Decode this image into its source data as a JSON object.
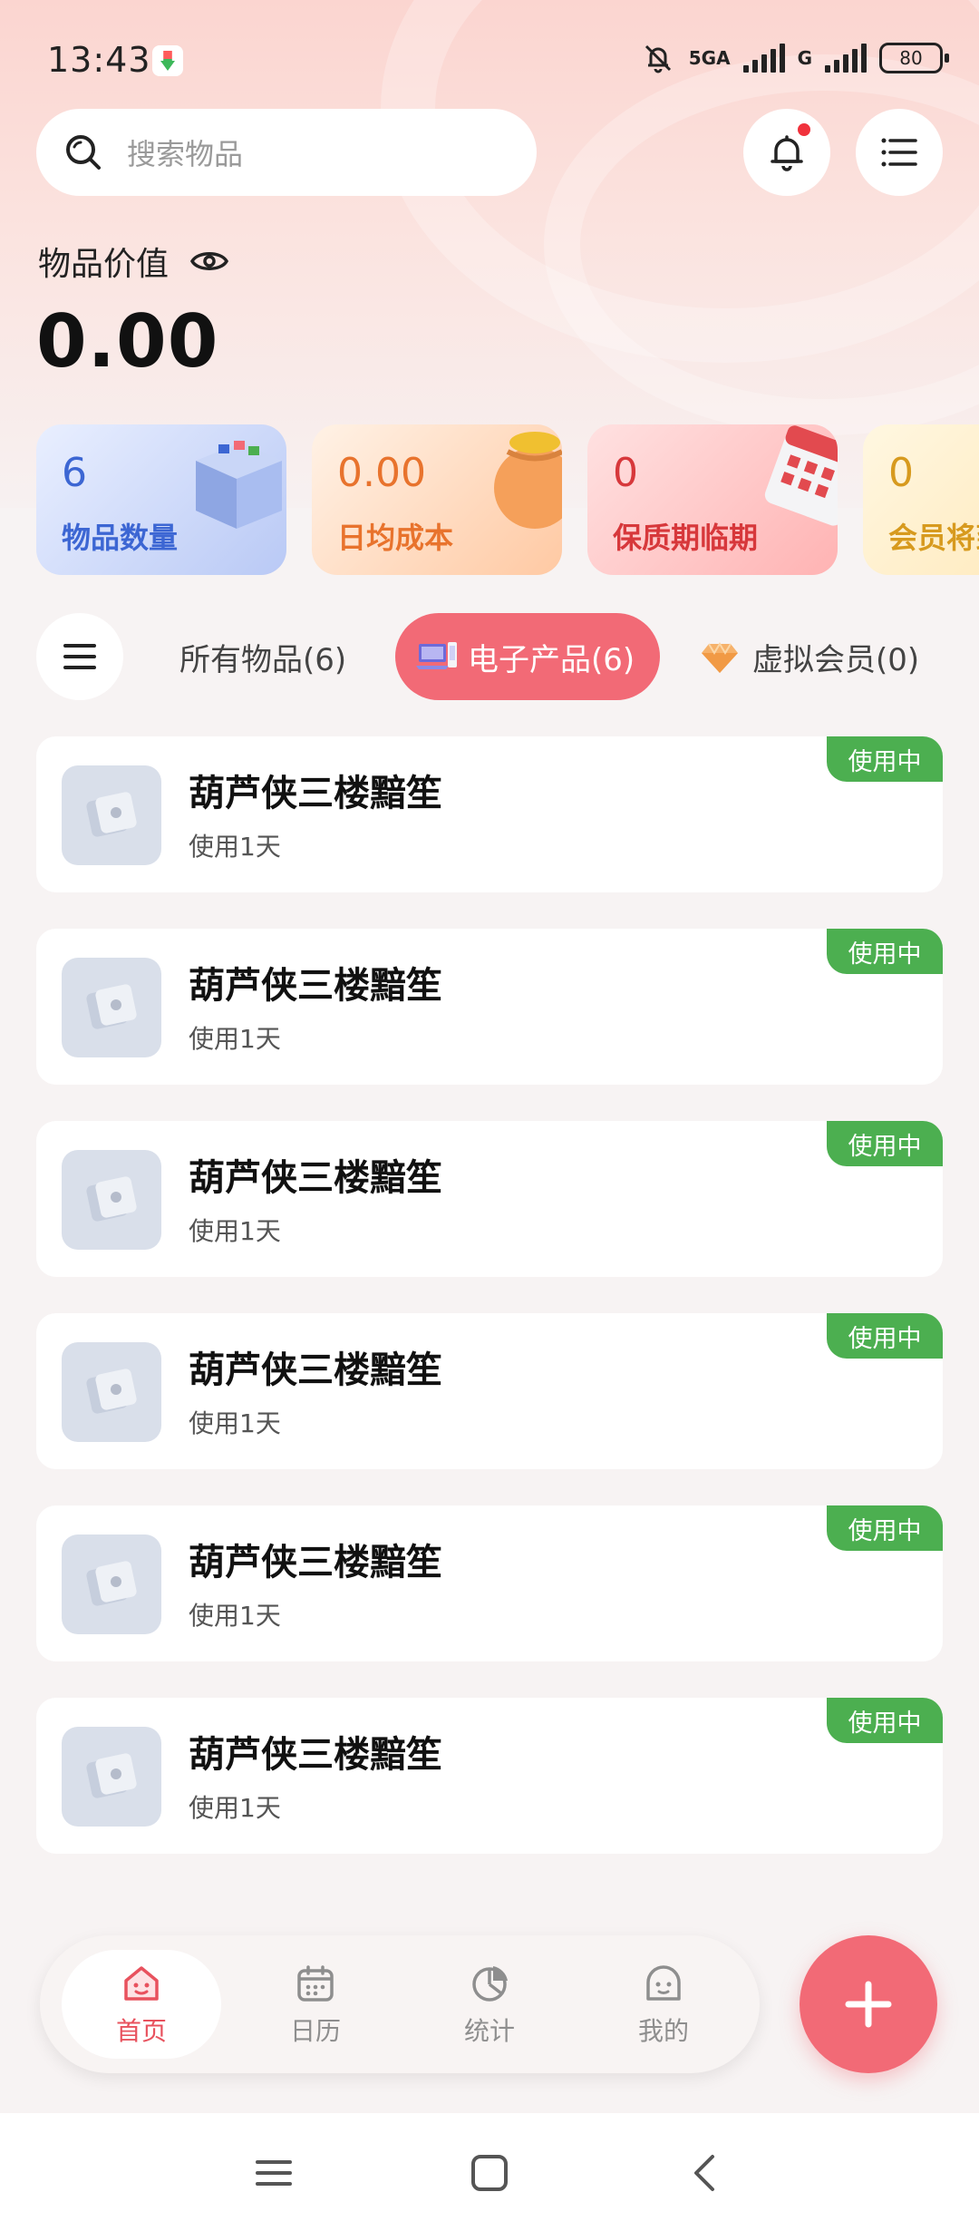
{
  "status_bar": {
    "time": "13:43",
    "network_1": "5GA",
    "network_2": "G",
    "battery": "80"
  },
  "search": {
    "placeholder": "搜索物品"
  },
  "value": {
    "label": "物品价值",
    "amount": "0.00"
  },
  "stats": [
    {
      "value": "6",
      "label": "物品数量",
      "color": "#3c66d3"
    },
    {
      "value": "0.00",
      "label": "日均成本",
      "color": "#e8732d"
    },
    {
      "value": "0",
      "label": "保质期临期",
      "color": "#d7383b"
    },
    {
      "value": "0",
      "label": "会员将到期",
      "color": "#d79a1e"
    }
  ],
  "tabs": [
    {
      "label": "所有物品(6)",
      "active": false
    },
    {
      "label": "电子产品(6)",
      "active": true,
      "icon": "laptop-icon"
    },
    {
      "label": "虚拟会员(0)",
      "active": false,
      "icon": "diamond-icon"
    }
  ],
  "items": [
    {
      "title": "葫芦侠三楼黯笙",
      "sub": "使用1天",
      "status": "使用中"
    },
    {
      "title": "葫芦侠三楼黯笙",
      "sub": "使用1天",
      "status": "使用中"
    },
    {
      "title": "葫芦侠三楼黯笙",
      "sub": "使用1天",
      "status": "使用中"
    },
    {
      "title": "葫芦侠三楼黯笙",
      "sub": "使用1天",
      "status": "使用中"
    },
    {
      "title": "葫芦侠三楼黯笙",
      "sub": "使用1天",
      "status": "使用中"
    },
    {
      "title": "葫芦侠三楼黯笙",
      "sub": "使用1天",
      "status": "使用中"
    }
  ],
  "bottom_nav": [
    {
      "label": "首页",
      "icon": "home-face-icon",
      "active": true
    },
    {
      "label": "日历",
      "icon": "calendar-icon",
      "active": false
    },
    {
      "label": "统计",
      "icon": "pie-chart-icon",
      "active": false
    },
    {
      "label": "我的",
      "icon": "profile-face-icon",
      "active": false
    }
  ],
  "colors": {
    "accent": "#f26a76",
    "status_green": "#4caf50",
    "notification_dot": "#f0323c"
  }
}
